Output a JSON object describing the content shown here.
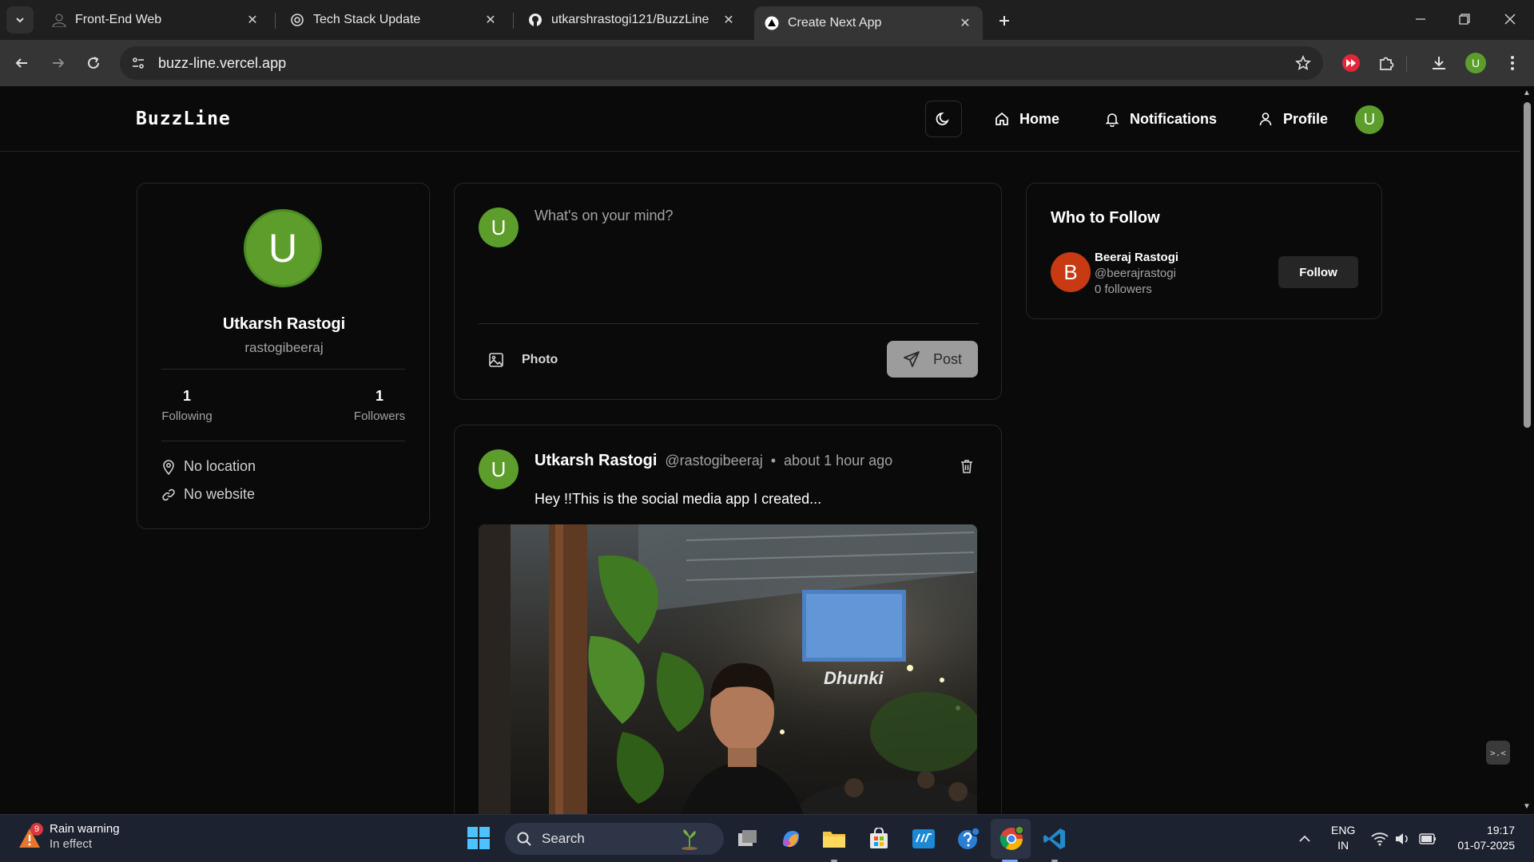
{
  "browser": {
    "tabs": [
      {
        "title": "Front-End Web",
        "favicon": "user-silhouette-icon"
      },
      {
        "title": "Tech Stack Update",
        "favicon": "openai-icon"
      },
      {
        "title": "utkarshrastogi121/BuzzLine",
        "favicon": "github-icon"
      },
      {
        "title": "Create Next App",
        "favicon": "vercel-triangle-icon",
        "active": true
      }
    ],
    "url": "buzz-line.vercel.app",
    "profile_initial": "U"
  },
  "app": {
    "logo": "BuzzLine",
    "nav": {
      "home": "Home",
      "notifications": "Notifications",
      "profile": "Profile"
    },
    "user_initial": "U"
  },
  "profile_card": {
    "initial": "U",
    "name": "Utkarsh Rastogi",
    "username": "rastogibeeraj",
    "following_count": "1",
    "following_label": "Following",
    "followers_count": "1",
    "followers_label": "Followers",
    "location": "No location",
    "website": "No website"
  },
  "composer": {
    "initial": "U",
    "placeholder": "What's on your mind?",
    "photo_label": "Photo",
    "post_label": "Post"
  },
  "post": {
    "initial": "U",
    "author": "Utkarsh Rastogi",
    "handle": "@rastogibeeraj",
    "separator": "•",
    "time": "about 1 hour ago",
    "content": "Hey !!This is the social media app I created...",
    "image_sign": "Dhunki"
  },
  "who_to_follow": {
    "title": "Who to Follow",
    "users": [
      {
        "initial": "B",
        "name": "Beeraj Rastogi",
        "handle": "@beerajrastogi",
        "followers": "0 followers",
        "button": "Follow"
      }
    ]
  },
  "dev_badge": ">.<",
  "taskbar": {
    "weather_badge": "9",
    "weather_title": "Rain warning",
    "weather_sub": "In effect",
    "search_label": "Search",
    "lang_1": "ENG",
    "lang_2": "IN",
    "time": "19:17",
    "date": "01-07-2025"
  },
  "colors": {
    "accent_green": "#5c9d2b",
    "follow_avatar": "#c83a12",
    "background": "#0a0a0a"
  }
}
